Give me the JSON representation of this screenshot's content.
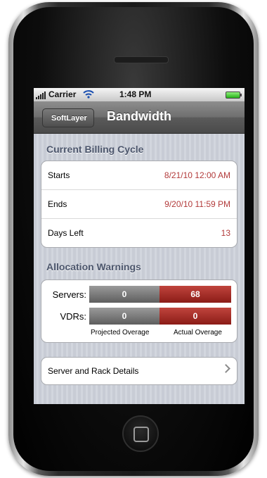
{
  "status_bar": {
    "carrier": "Carrier",
    "time": "1:48 PM"
  },
  "nav": {
    "back_label": "SoftLayer",
    "title": "Bandwidth"
  },
  "billing": {
    "header": "Current Billing Cycle",
    "rows": [
      {
        "label": "Starts",
        "value": "8/21/10 12:00 AM"
      },
      {
        "label": "Ends",
        "value": "9/20/10 11:59 PM"
      },
      {
        "label": "Days Left",
        "value": "13"
      }
    ]
  },
  "warnings": {
    "header": "Allocation Warnings",
    "rows": [
      {
        "label": "Servers:",
        "projected": "0",
        "actual": "68"
      },
      {
        "label": "VDRs:",
        "projected": "0",
        "actual": "0"
      }
    ],
    "legend_projected": "Projected Overage",
    "legend_actual": "Actual Overage"
  },
  "details": {
    "label": "Server and Rack Details"
  },
  "colors": {
    "value_red": "#b23a3a",
    "bar_red": "#8b1c17",
    "bar_gray": "#5e5e5e",
    "section_header": "#4c566c"
  }
}
